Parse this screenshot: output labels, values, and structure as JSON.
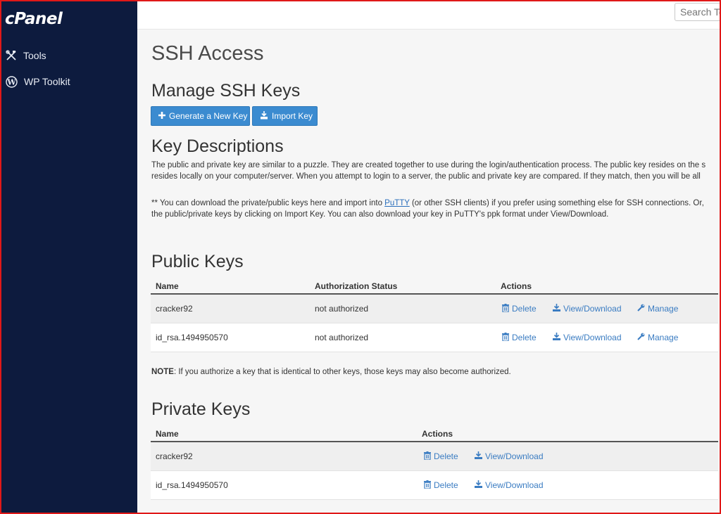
{
  "sidebar": {
    "logo": "cPanel",
    "items": [
      {
        "label": "Tools",
        "icon": "tools-icon"
      },
      {
        "label": "WP Toolkit",
        "icon": "wordpress-icon"
      }
    ]
  },
  "header": {
    "search_placeholder": "Search Tools"
  },
  "page": {
    "title": "SSH Access",
    "manage_heading": "Manage SSH Keys",
    "generate_button": "Generate a New Key",
    "import_button": "Import Key",
    "key_desc_heading": "Key Descriptions",
    "desc_line1": "The public and private key are similar to a puzzle. They are created together to use during the login/authentication process. The public key resides on the s",
    "desc_line2": "resides locally on your computer/server. When you attempt to login to a server, the public and private key are compared. If they match, then you will be all",
    "dl_line1_pre": "** You can download the private/public keys here and import into ",
    "dl_link": "PuTTY",
    "dl_line1_post": " (or other SSH clients) if you prefer using something else for SSH connections. Or, ",
    "dl_line2": "the public/private keys by clicking on Import Key. You can also download your key in PuTTY's ppk format under View/Download.",
    "note_label": "NOTE",
    "note_text": ": If you authorize a key that is identical to other keys, those keys may also become authorized."
  },
  "public_keys": {
    "heading": "Public Keys",
    "columns": [
      "Name",
      "Authorization Status",
      "Actions"
    ],
    "rows": [
      {
        "name": "cracker92",
        "status": "not authorized"
      },
      {
        "name": "id_rsa.1494950570",
        "status": "not authorized"
      }
    ],
    "actions": [
      "Delete",
      "View/Download",
      "Manage"
    ]
  },
  "private_keys": {
    "heading": "Private Keys",
    "columns": [
      "Name",
      "Actions"
    ],
    "rows": [
      {
        "name": "cracker92"
      },
      {
        "name": "id_rsa.1494950570"
      }
    ],
    "actions": [
      "Delete",
      "View/Download"
    ]
  },
  "colors": {
    "sidebar_bg": "#0d1b3e",
    "button_bg": "#3b8bd0",
    "link": "#3a7cc2",
    "frame_border": "#e01818"
  }
}
